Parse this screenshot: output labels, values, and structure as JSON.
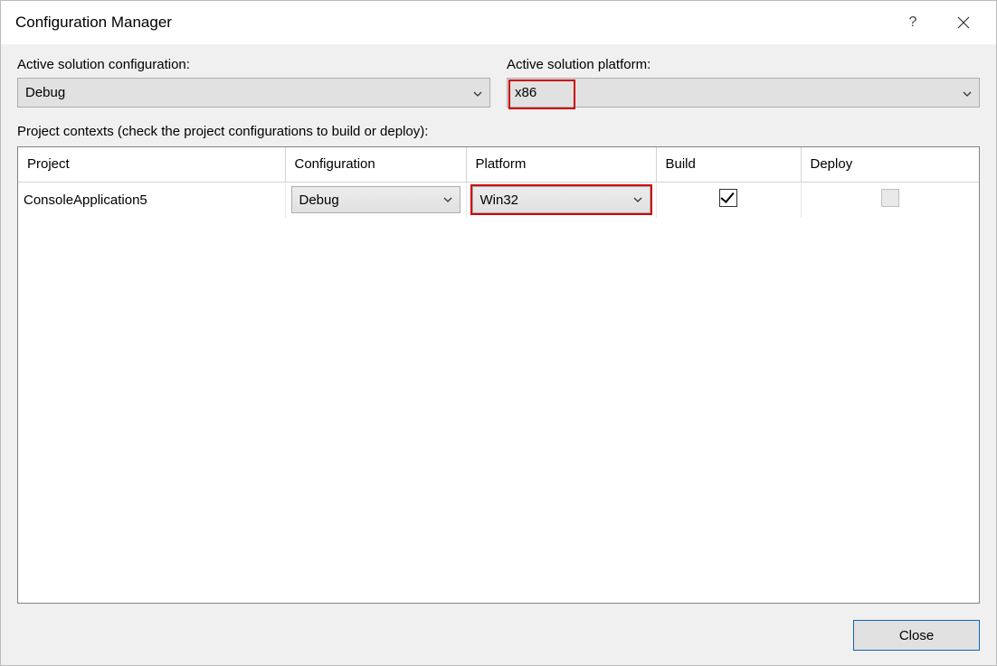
{
  "window": {
    "title": "Configuration Manager"
  },
  "fields": {
    "config_label": "Active solution configuration:",
    "config_value": "Debug",
    "platform_label": "Active solution platform:",
    "platform_value": "x86"
  },
  "section_label": "Project contexts (check the project configurations to build or deploy):",
  "columns": {
    "project": "Project",
    "configuration": "Configuration",
    "platform": "Platform",
    "build": "Build",
    "deploy": "Deploy"
  },
  "rows": [
    {
      "project": "ConsoleApplication5",
      "configuration": "Debug",
      "platform": "Win32",
      "build": true,
      "deploy_enabled": false
    }
  ],
  "footer": {
    "close": "Close"
  }
}
